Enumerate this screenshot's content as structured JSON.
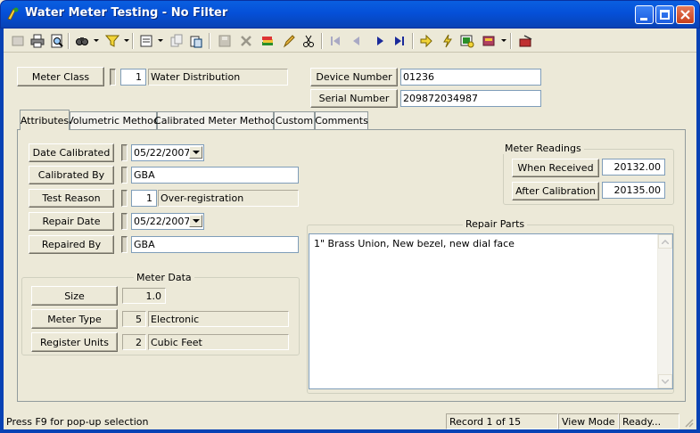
{
  "window": {
    "title": "Water Meter Testing - No Filter"
  },
  "toolbar": {
    "icons": [
      "first-record",
      "print",
      "print-preview",
      "find",
      "filter",
      "view",
      "copy",
      "paste",
      "save",
      "delete",
      "add-stack",
      "edit",
      "cut",
      "first",
      "previous",
      "next",
      "last",
      "go",
      "calculate",
      "lookup",
      "tools",
      "exit"
    ]
  },
  "header": {
    "meter_class_label": "Meter Class",
    "meter_class_code": "1",
    "meter_class_name": "Water Distribution",
    "device_number_label": "Device Number",
    "device_number_value": "01236",
    "serial_number_label": "Serial Number",
    "serial_number_value": "209872034987"
  },
  "tabs": [
    "Attributes",
    "Volumetric Method",
    "Calibrated Meter Method",
    "Custom",
    "Comments"
  ],
  "attributes": {
    "date_calibrated_label": "Date Calibrated",
    "date_calibrated_value": "05/22/2007",
    "calibrated_by_label": "Calibrated By",
    "calibrated_by_value": "GBA",
    "test_reason_label": "Test Reason",
    "test_reason_code": "1",
    "test_reason_name": "Over-registration",
    "repair_date_label": "Repair Date",
    "repair_date_value": "05/22/2007",
    "repaired_by_label": "Repaired By",
    "repaired_by_value": "GBA"
  },
  "meter_data": {
    "title": "Meter Data",
    "size_label": "Size",
    "size_value": "1.0",
    "meter_type_label": "Meter Type",
    "meter_type_code": "5",
    "meter_type_name": "Electronic",
    "register_units_label": "Register Units",
    "register_units_code": "2",
    "register_units_name": "Cubic Feet"
  },
  "meter_readings": {
    "title": "Meter Readings",
    "when_received_label": "When Received",
    "when_received_value": "20132.00",
    "after_calibration_label": "After Calibration",
    "after_calibration_value": "20135.00"
  },
  "repair_parts": {
    "title": "Repair Parts",
    "text": "1\" Brass Union, New bezel, new dial face"
  },
  "status": {
    "hint": "Press F9 for pop-up selection",
    "record": "Record 1 of 15",
    "mode": "View Mode",
    "state": "Ready..."
  },
  "colors": {
    "titlebar": "#0550D8",
    "face": "#ECE9D8",
    "close": "#C8401C"
  }
}
